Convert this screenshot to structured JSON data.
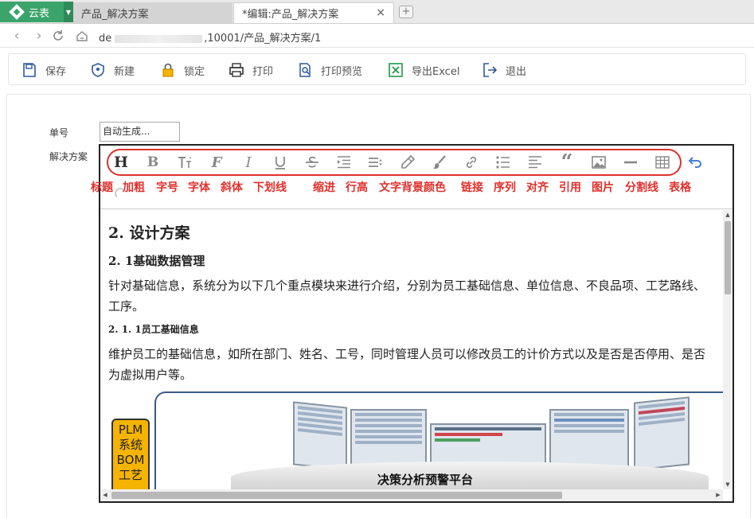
{
  "tabs": {
    "app_label": "云表",
    "inactive_label": "产品_解决方案",
    "active_label": "*编辑:产品_解决方案",
    "close_glyph": "×",
    "new_glyph": "+"
  },
  "address": {
    "url_prefix": "de",
    "url_visible": ",10001/产品_解决方案/1"
  },
  "toolbar": {
    "save": "保存",
    "new": "新建",
    "lock": "锁定",
    "print": "打印",
    "print_preview": "打印预览",
    "export_excel": "导出Excel",
    "exit": "退出"
  },
  "form": {
    "number_label": "单号",
    "number_value": "自动生成...",
    "solution_label": "解决方案"
  },
  "editor": {
    "buttons": [
      "heading",
      "bold",
      "font-size",
      "font",
      "italic",
      "underline",
      "strikethrough",
      "indent",
      "line-height",
      "text-bg-color",
      "brush",
      "link",
      "list",
      "align",
      "quote",
      "image",
      "divider",
      "table",
      "undo"
    ],
    "annotations": [
      "标题",
      "加粗",
      "字号",
      "字体",
      "斜体",
      "下划线",
      "缩进",
      "行高",
      "文字背景颜色",
      "链接",
      "序列",
      "对齐",
      "引用",
      "图片",
      "分割线",
      "表格"
    ]
  },
  "content": {
    "h2": "2. 设计方案",
    "h3": "2. 1基础数据管理",
    "p1": "针对基础信息，系统分为以下几个重点模块来进行介绍，分别为员工基础信息、单位信息、不良品项、工艺路线、工序。",
    "h4": "2. 1. 1员工基础信息",
    "p2": "维护员工的基础信息，如所在部门、姓名、工号，同时管理人员可以修改员工的计价方式以及是否是否停用、是否为虚拟用户等。",
    "plm_text": "PLM系统BOM工艺",
    "image_caption": "决策分析预警平台"
  },
  "colors": {
    "brand_green": "#3aa46a",
    "annotation_red": "#e0302c",
    "plm_yellow": "#f5b400"
  }
}
